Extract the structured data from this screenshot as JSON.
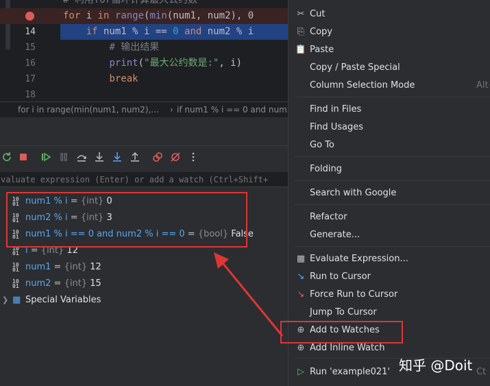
{
  "editor": {
    "lines": [
      {
        "num": "",
        "tokens": [
          {
            "t": "# 利用for循环计算最大公约数",
            "c": "cmt"
          }
        ]
      },
      {
        "num": "",
        "breakpoint": true,
        "tokens": [
          {
            "t": "for",
            "c": "kw"
          },
          {
            "t": " i ",
            "c": ""
          },
          {
            "t": "in",
            "c": "kw"
          },
          {
            "t": " ",
            "c": ""
          },
          {
            "t": "range",
            "c": "bi"
          },
          {
            "t": "(",
            "c": ""
          },
          {
            "t": "min",
            "c": "bi"
          },
          {
            "t": "(num1, num2), 0",
            "c": ""
          }
        ]
      },
      {
        "num": "14",
        "current": true,
        "tokens": [
          {
            "t": "    ",
            "c": ""
          },
          {
            "t": "if",
            "c": "kw"
          },
          {
            "t": " num1 % i == ",
            "c": ""
          },
          {
            "t": "0",
            "c": "num"
          },
          {
            "t": " ",
            "c": ""
          },
          {
            "t": "and",
            "c": "kw"
          },
          {
            "t": " num2 % i",
            "c": ""
          }
        ]
      },
      {
        "num": "15",
        "tokens": [
          {
            "t": "        ",
            "c": ""
          },
          {
            "t": "# 输出结果",
            "c": "cmt"
          }
        ]
      },
      {
        "num": "16",
        "tokens": [
          {
            "t": "        ",
            "c": ""
          },
          {
            "t": "print",
            "c": "bi"
          },
          {
            "t": "(",
            "c": ""
          },
          {
            "t": "\"最大公约数是:\"",
            "c": "str"
          },
          {
            "t": ", i)",
            "c": ""
          }
        ]
      },
      {
        "num": "17",
        "tokens": [
          {
            "t": "        ",
            "c": ""
          },
          {
            "t": "break",
            "c": "kw"
          }
        ]
      },
      {
        "num": "18",
        "tokens": []
      }
    ],
    "breadcrumb": [
      "for i in range(min(num1, num2),...",
      "if num1 % i == 0 and num2"
    ]
  },
  "debugger": {
    "eval_placeholder": "valuate expression (Enter) or add a watch (Ctrl+Shift+",
    "watches": [
      {
        "name": "num1 % i",
        "type": "{int}",
        "value": "0"
      },
      {
        "name": "num2 % i",
        "type": "{int}",
        "value": "3"
      },
      {
        "name": "num1 % i == 0 and num2 % i == 0",
        "type": "{bool}",
        "value": "False"
      }
    ],
    "variables": [
      {
        "name": "i",
        "type": "{int}",
        "value": "12"
      },
      {
        "name": "num1",
        "type": "{int}",
        "value": "12"
      },
      {
        "name": "num2",
        "type": "{int}",
        "value": "15"
      }
    ],
    "special": "Special Variables",
    "var_icon": "10\n01"
  },
  "menu": {
    "items": [
      {
        "icon": "✂",
        "label": "Cut"
      },
      {
        "icon": "⎘",
        "label": "Copy"
      },
      {
        "icon": "📋",
        "label": "Paste"
      },
      {
        "icon": "",
        "label": "Copy / Paste Special"
      },
      {
        "icon": "",
        "label": "Column Selection Mode",
        "shortcut": "Alt+"
      },
      {
        "icon": "",
        "label": "Find in Files"
      },
      {
        "icon": "",
        "label": "Find Usages"
      },
      {
        "icon": "",
        "label": "Go To"
      },
      {
        "icon": "",
        "label": "Folding"
      },
      {
        "icon": "",
        "label": "Search with Google"
      },
      {
        "icon": "",
        "label": "Refactor"
      },
      {
        "icon": "",
        "label": "Generate..."
      },
      {
        "icon": "▦",
        "label": "Evaluate Expression..."
      },
      {
        "icon": "↘",
        "label": "Run to Cursor"
      },
      {
        "icon": "↘",
        "label": "Force Run to Cursor"
      },
      {
        "icon": "",
        "label": "Jump To Cursor"
      },
      {
        "icon": "⊕",
        "label": "Add to Watches"
      },
      {
        "icon": "⊕",
        "label": "Add Inline Watch"
      },
      {
        "icon": "▷",
        "label": "Run 'example021'",
        "shortcut": "Ct"
      }
    ]
  },
  "watermark": "知乎 @Doit",
  "colors": {
    "highlight": "#e03535",
    "selection": "#214283",
    "breakpoint_line": "#3a2323"
  }
}
